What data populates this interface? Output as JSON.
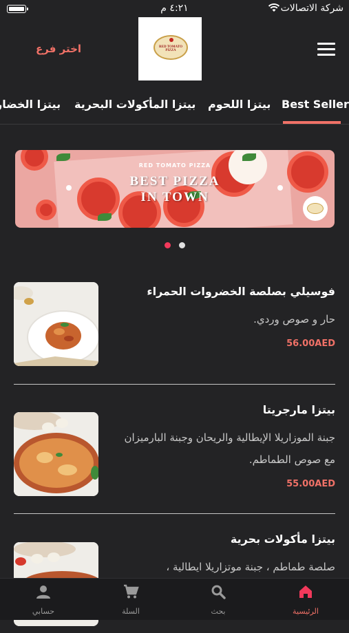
{
  "status_bar": {
    "carrier": "شركة الاتصالات",
    "time": "٤:٢١ م"
  },
  "header": {
    "branch_label": "اختر فرع",
    "logo_text": "RED TOMATO PIZZA"
  },
  "tabs": [
    {
      "label": "Best Seller",
      "active": true
    },
    {
      "label": "بيتزا اللحوم"
    },
    {
      "label": "بيتزا المأكولات البحرية"
    },
    {
      "label": "بيتزا الخضار"
    }
  ],
  "banner": {
    "subtitle": "RED TOMATO PIZZA",
    "title_line1": "BEST PIZZA",
    "title_line2": "IN TOWN"
  },
  "pager": {
    "count": 2,
    "active_index": 0
  },
  "products": [
    {
      "name": "فوسيلي بصلصة الخضروات الحمراء",
      "description": "حار و صوص وردي.",
      "price": "56.00AED",
      "image_icon": "pasta-dish"
    },
    {
      "name": "بيتزا مارجريتا",
      "description": "جبنة الموزاريلا الإيطالية والريحان وجبنة البارميزان مع صوص الطماطم.",
      "price": "55.00AED",
      "image_icon": "pizza-dish"
    },
    {
      "name": "بيتزا مأكولات بحرية",
      "description": "صلصة طماطم ، جبنة موتزاريلا ايطالية ،",
      "price": "",
      "image_icon": "pizza-dish"
    }
  ],
  "bottom_nav": [
    {
      "label": "الرئيسية",
      "icon": "home-icon",
      "active": true
    },
    {
      "label": "بحث",
      "icon": "search-icon"
    },
    {
      "label": "السلة",
      "icon": "cart-icon"
    },
    {
      "label": "حسابي",
      "icon": "account-icon"
    }
  ],
  "colors": {
    "background": "#232325",
    "accent": "#f07167",
    "nav_background": "#1b1b1d"
  }
}
